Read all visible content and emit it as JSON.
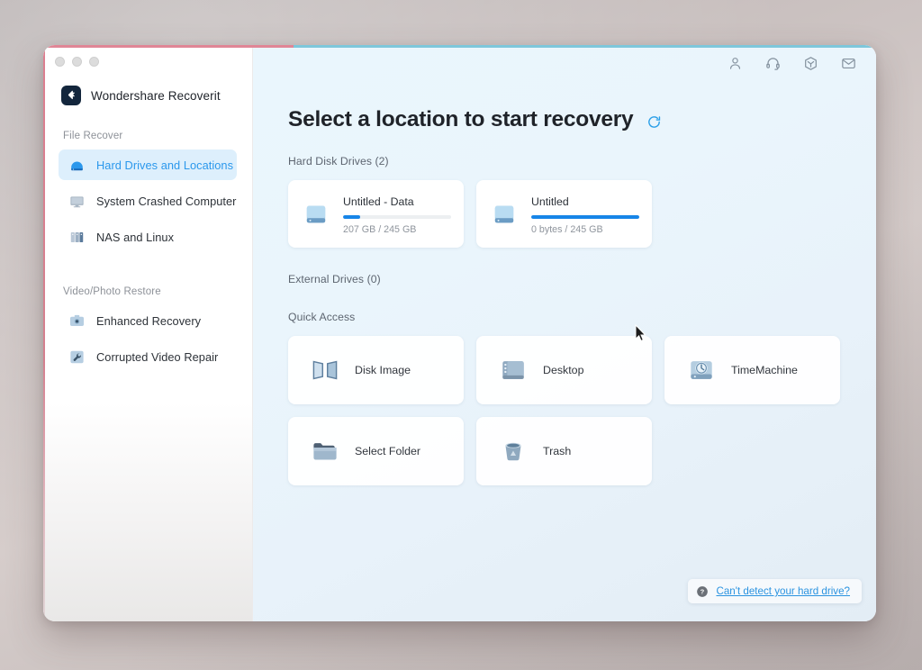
{
  "window": {
    "app_title": "Wondershare Recoverit",
    "traffic_lights": [
      "close",
      "minimize",
      "maximize"
    ]
  },
  "sidebar": {
    "groups": [
      {
        "label": "File Recover",
        "items": [
          {
            "label": "Hard Drives and Locations",
            "icon": "hard-drive-icon",
            "active": true
          },
          {
            "label": "System Crashed Computer",
            "icon": "monitor-icon",
            "active": false
          },
          {
            "label": "NAS and Linux",
            "icon": "nas-server-icon",
            "active": false
          }
        ]
      },
      {
        "label": "Video/Photo Restore",
        "items": [
          {
            "label": "Enhanced Recovery",
            "icon": "camera-icon",
            "active": false
          },
          {
            "label": "Corrupted Video Repair",
            "icon": "wrench-icon",
            "active": false
          }
        ]
      }
    ]
  },
  "header": {
    "icons": [
      {
        "name": "account-icon"
      },
      {
        "name": "support-headset-icon"
      },
      {
        "name": "package-box-icon"
      },
      {
        "name": "mail-icon"
      }
    ]
  },
  "main": {
    "page_title": "Select a location to start recovery",
    "refresh_icon": "refresh-icon",
    "hard_disk_section_label": "Hard Disk Drives (2)",
    "external_section_label": "External Drives (0)",
    "quick_access_label": "Quick Access",
    "drives": [
      {
        "name": "Untitled - Data",
        "stats": "207 GB / 245 GB",
        "fill_percent": 16,
        "icon": "hard-drive-icon"
      },
      {
        "name": "Untitled",
        "stats": "0 bytes / 245 GB",
        "fill_percent": 100,
        "icon": "hard-drive-icon"
      }
    ],
    "quick_access": [
      {
        "label": "Disk Image",
        "icon": "disk-image-icon"
      },
      {
        "label": "Desktop",
        "icon": "desktop-folder-icon"
      },
      {
        "label": "TimeMachine",
        "icon": "time-machine-icon"
      },
      {
        "label": "Select Folder",
        "icon": "folder-icon"
      },
      {
        "label": "Trash",
        "icon": "trash-icon"
      }
    ],
    "help": {
      "icon": "question-mark-icon",
      "link_text": "Can't detect your hard drive?"
    }
  },
  "colors": {
    "accent_blue": "#1785e8",
    "active_nav_text": "#2b98ec",
    "active_nav_bg": "#ddeffc",
    "link_blue": "#2b93e0",
    "title_text": "#1f2329",
    "top_border_pink": "#e08696",
    "top_border_teal": "#7ec7db"
  }
}
